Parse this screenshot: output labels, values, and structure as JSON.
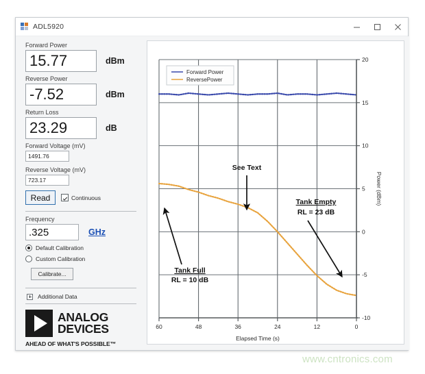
{
  "window": {
    "title": "ADL5920",
    "icon": "app-icon",
    "buttons": {
      "minimize": "minimize-icon",
      "maximize": "maximize-icon",
      "close": "close-icon"
    }
  },
  "panel": {
    "forward_power": {
      "label": "Forward Power",
      "value": "15.77",
      "unit": "dBm"
    },
    "reverse_power": {
      "label": "Reverse Power",
      "value": "-7.52",
      "unit": "dBm"
    },
    "return_loss": {
      "label": "Return Loss",
      "value": "23.29",
      "unit": "dB"
    },
    "forward_voltage": {
      "label": "Forward Voltage (mV)",
      "value": "1491.76"
    },
    "reverse_voltage": {
      "label": "Reverse Voltage (mV)",
      "value": "723.17"
    },
    "read_button": "Read",
    "continuous_checkbox": {
      "label": "Continuous",
      "checked": "true"
    },
    "frequency": {
      "label": "Frequency",
      "value": ".325",
      "unit": "GHz"
    },
    "default_calibration": "Default Calibration",
    "custom_calibration": "Custom Calibration",
    "calibrate_button": "Calibrate...",
    "additional_data": "Additional Data",
    "logo": {
      "line1": "ANALOG",
      "line2": "DEVICES",
      "tagline": "AHEAD OF WHAT'S POSSIBLE™"
    }
  },
  "chart_data": {
    "type": "line",
    "title": "",
    "xlabel": "Elapsed Time (s)",
    "ylabel": "Power (dBm)",
    "xticks": [
      "60",
      "48",
      "36",
      "24",
      "12",
      "0"
    ],
    "yticks": [
      "-10",
      "-5",
      "0",
      "5",
      "10",
      "15",
      "20"
    ],
    "xlim": [
      60,
      0
    ],
    "ylim": [
      -10,
      20
    ],
    "x_reversed": "true",
    "grid": "true",
    "legend_position": "top-left",
    "series": [
      {
        "name": "Forward Power",
        "color": "#3949ab",
        "style": "dotted",
        "x": [
          60,
          57,
          54,
          51,
          48,
          45,
          42,
          39,
          36,
          33,
          30,
          27,
          24,
          21,
          18,
          15,
          12,
          9,
          6,
          3,
          0
        ],
        "values": [
          16.0,
          16.0,
          15.9,
          16.1,
          16.0,
          15.9,
          16.0,
          16.1,
          16.0,
          15.9,
          16.0,
          16.0,
          16.1,
          15.9,
          16.0,
          16.0,
          15.9,
          16.0,
          16.1,
          16.0,
          15.9
        ]
      },
      {
        "name": "ReversePower",
        "color": "#e8a33d",
        "style": "dotted",
        "x": [
          60,
          57,
          54,
          51,
          48,
          45,
          42,
          39,
          36,
          33,
          30,
          27,
          24,
          21,
          18,
          15,
          12,
          9,
          6,
          3,
          0
        ],
        "values": [
          5.6,
          5.5,
          5.3,
          4.9,
          4.6,
          4.2,
          3.9,
          3.5,
          3.2,
          2.8,
          2.2,
          1.2,
          0.0,
          -1.3,
          -2.6,
          -3.9,
          -5.1,
          -6.1,
          -6.8,
          -7.2,
          -7.4
        ]
      }
    ],
    "annotations": [
      {
        "name": "tank-full",
        "line1": "Tank Full",
        "line2": "RL = 10 dB"
      },
      {
        "name": "see-text",
        "line1": "See Text"
      },
      {
        "name": "tank-empty",
        "line1": "Tank Empty",
        "line2": "RL = 23 dB"
      }
    ]
  },
  "watermark": "www.cntronics.com"
}
